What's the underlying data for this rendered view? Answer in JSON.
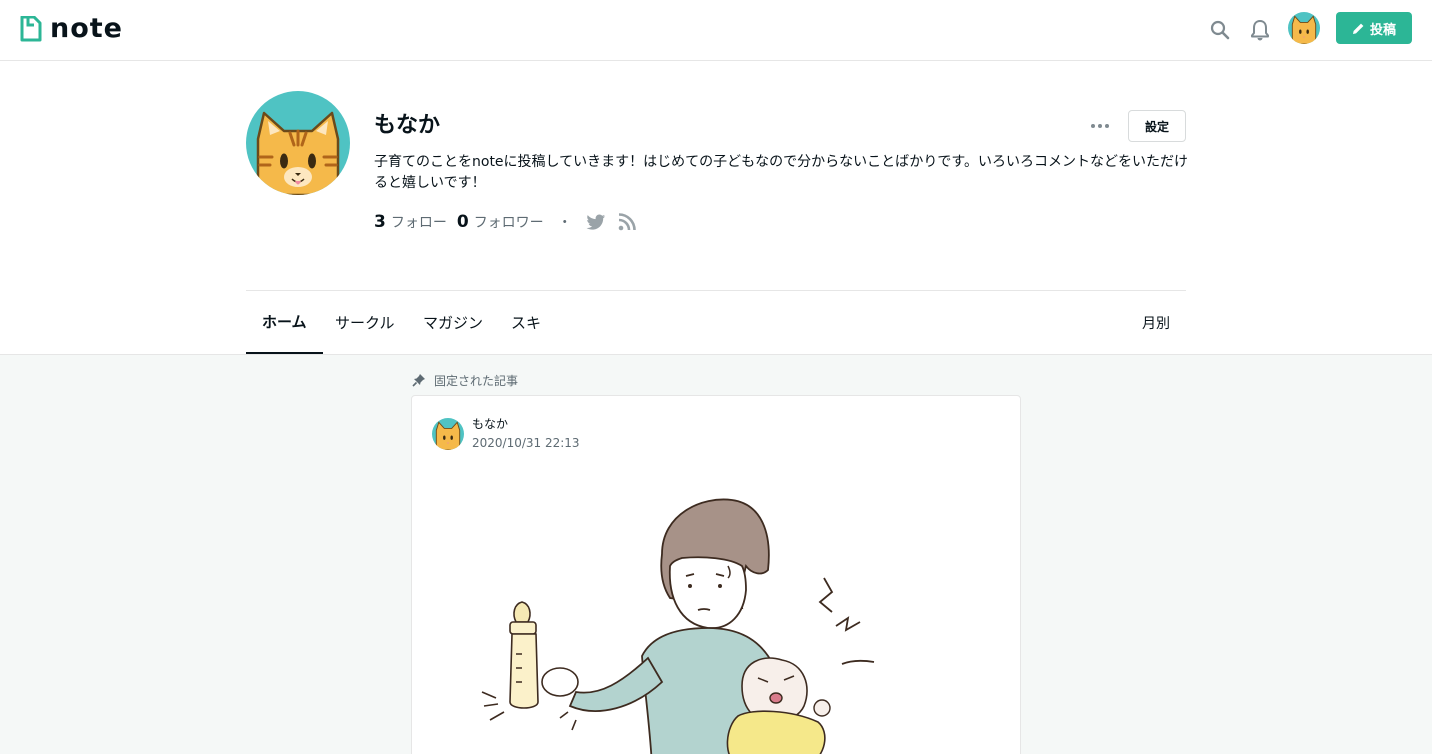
{
  "header": {
    "logo_text": "note",
    "post_button_label": "投稿",
    "icons": [
      "search-icon",
      "bell-icon",
      "pencil-icon"
    ]
  },
  "profile": {
    "name": "もなか",
    "bio": "子育てのことをnoteに投稿していきます！はじめての子どもなので分からないことばかりです。いろいろコメントなどをいただけると嬉しいです！",
    "settings_label": "設定",
    "follow_count": "3",
    "follow_label": "フォロー",
    "follower_count": "0",
    "follower_label": "フォロワー",
    "separator": "・",
    "social_icons": [
      "twitter-icon",
      "rss-icon"
    ]
  },
  "tabs": {
    "items": [
      {
        "label": "ホーム",
        "active": true
      },
      {
        "label": "サークル",
        "active": false
      },
      {
        "label": "マガジン",
        "active": false
      },
      {
        "label": "スキ",
        "active": false
      }
    ],
    "monthly_label": "月別"
  },
  "pinned": {
    "label": "固定された記事",
    "card": {
      "author": "もなか",
      "date": "2020/10/31 22:13"
    }
  },
  "colors": {
    "brand": "#2cb696",
    "avatar_bg": "#4fc3c3",
    "cat_orange": "#f5b94a"
  }
}
